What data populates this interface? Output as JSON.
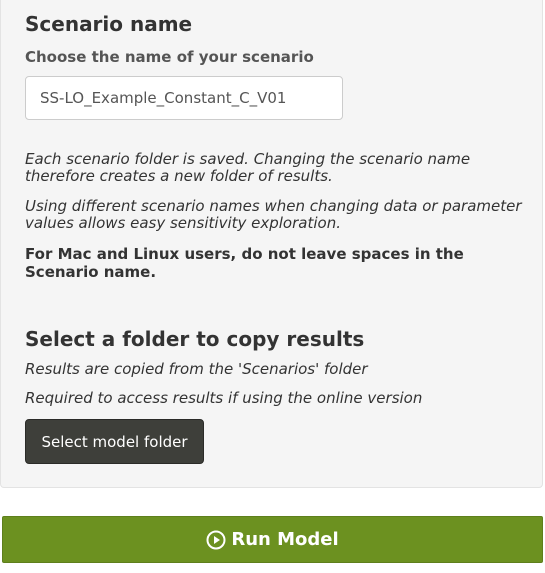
{
  "scenario": {
    "title": "Scenario name",
    "label": "Choose the name of your scenario",
    "input_value": "SS-LO_Example_Constant_C_V01",
    "note_1": "Each scenario folder is saved. Changing the scenario name therefore creates a new folder of results.",
    "note_2": "Using different scenario names when changing data or parameter values allows easy sensitivity exploration.",
    "warning": "For Mac and Linux users, do not leave spaces in the Scenario name."
  },
  "folder": {
    "title": "Select a folder to copy results",
    "note_1": "Results are copied from the 'Scenarios' folder",
    "note_2": "Required to access results if using the online version",
    "button_label": "Select model folder"
  },
  "run": {
    "button_label": "Run Model",
    "icon": "play-circle-icon",
    "color": "#6c9120"
  }
}
